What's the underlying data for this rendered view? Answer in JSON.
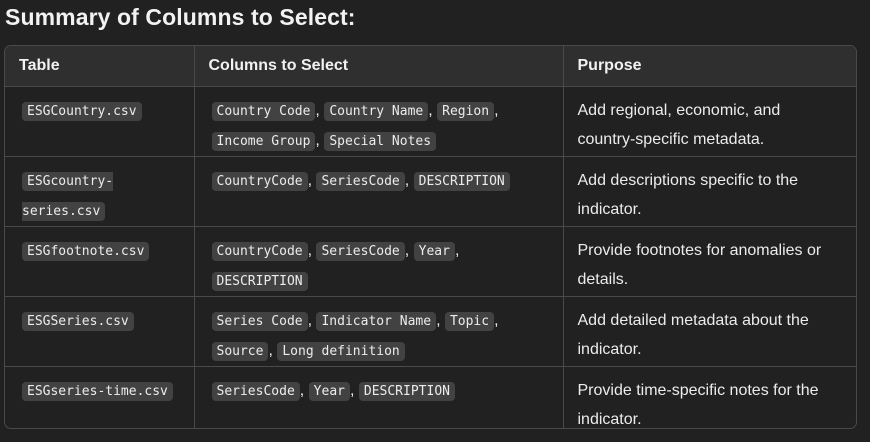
{
  "title": "Summary of Columns to Select:",
  "table": {
    "headers": [
      "Table",
      "Columns to Select",
      "Purpose"
    ],
    "rows": [
      {
        "table": "ESGCountry.csv",
        "columns": [
          "Country Code",
          "Country Name",
          "Region",
          "Income Group",
          "Special Notes"
        ],
        "purpose": "Add regional, economic, and country-specific metadata."
      },
      {
        "table": "ESGcountry-series.csv",
        "columns": [
          "CountryCode",
          "SeriesCode",
          "DESCRIPTION"
        ],
        "purpose": "Add descriptions specific to the indicator."
      },
      {
        "table": "ESGfootnote.csv",
        "columns": [
          "CountryCode",
          "SeriesCode",
          "Year",
          "DESCRIPTION"
        ],
        "purpose": "Provide footnotes for anomalies or details."
      },
      {
        "table": "ESGSeries.csv",
        "columns": [
          "Series Code",
          "Indicator Name",
          "Topic",
          "Source",
          "Long definition"
        ],
        "purpose": "Add detailed metadata about the indicator."
      },
      {
        "table": "ESGseries-time.csv",
        "columns": [
          "SeriesCode",
          "Year",
          "DESCRIPTION"
        ],
        "purpose": "Provide time-specific notes for the indicator."
      }
    ]
  },
  "colors": {
    "background": "#212121",
    "header_background": "#2f2f2f",
    "border": "#4a4a4a",
    "code_background": "#424242",
    "text": "#ececec"
  }
}
